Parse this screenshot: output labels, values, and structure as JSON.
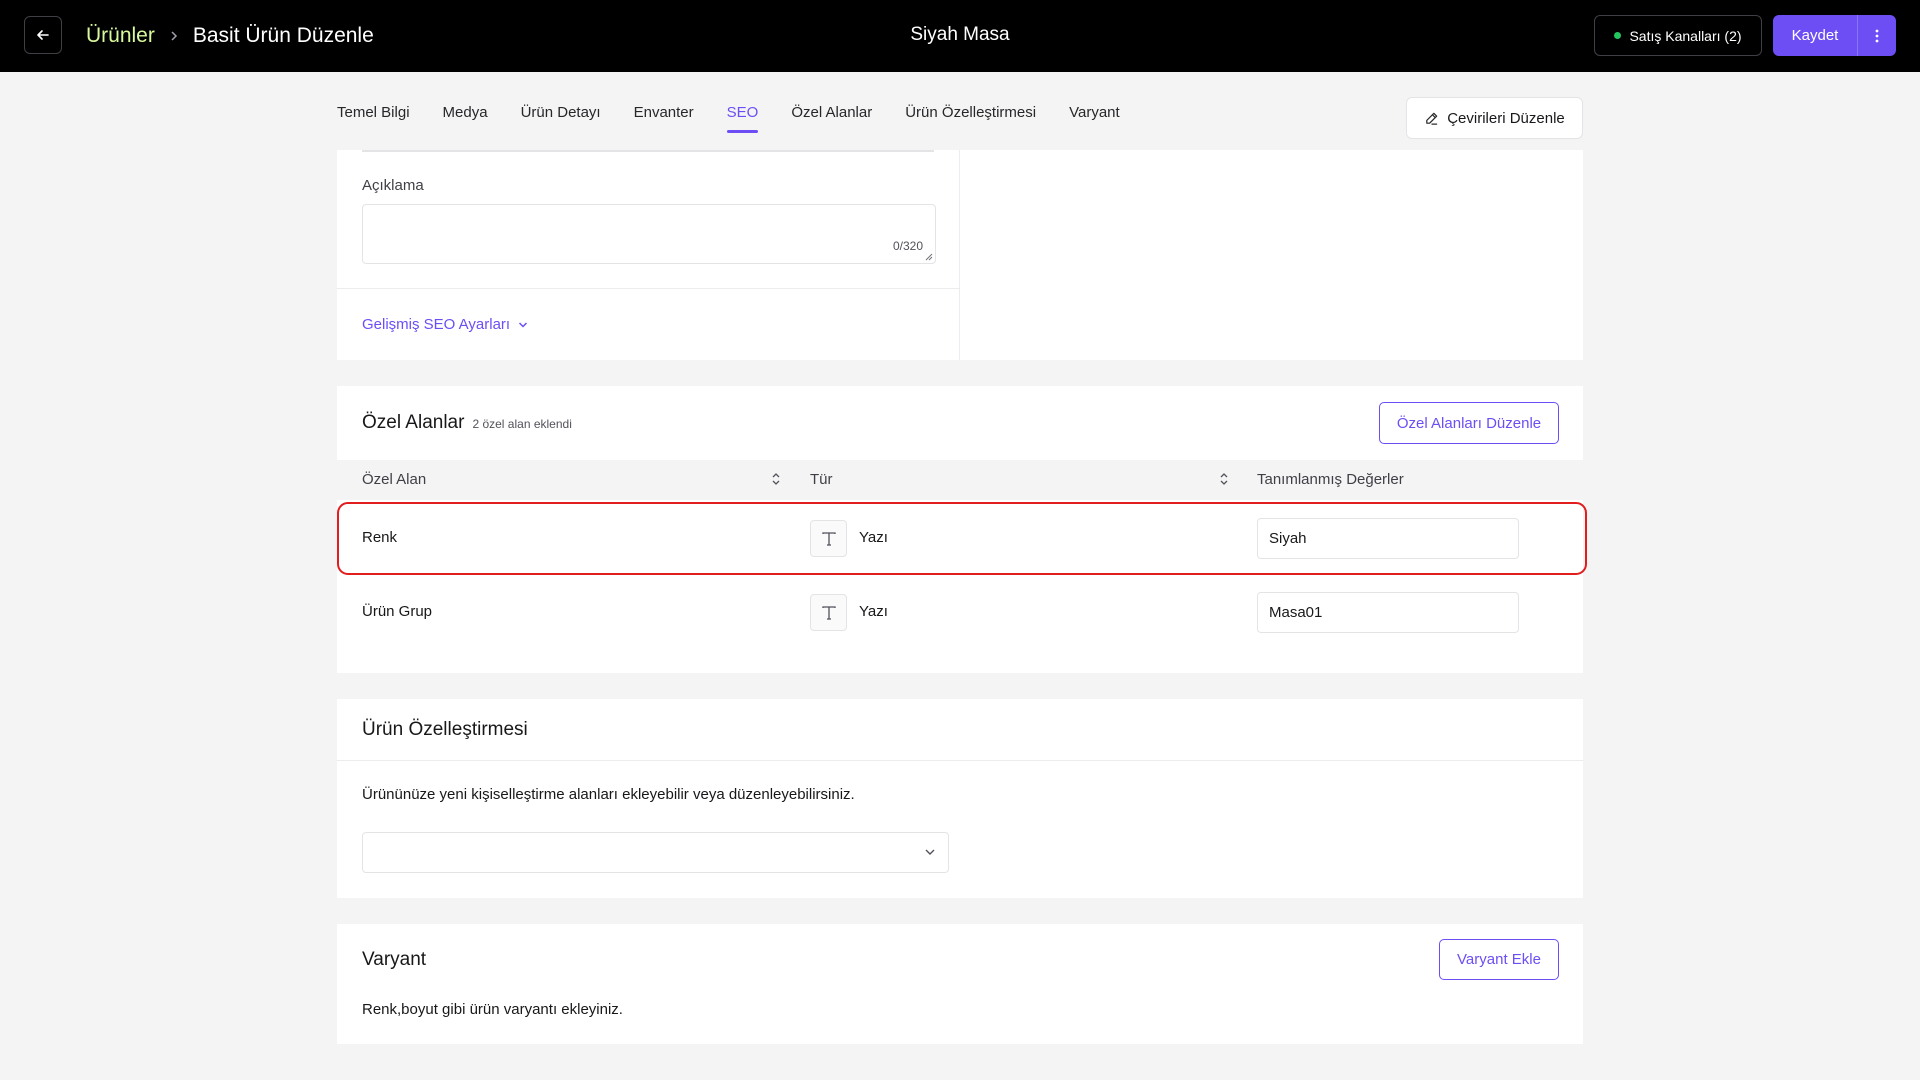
{
  "header": {
    "back_icon": "arrow-left-icon",
    "breadcrumb_parent": "Ürünler",
    "breadcrumb_current": "Basit Ürün Düzenle",
    "product_title": "Siyah Masa",
    "channels_label": "Satış Kanalları (2)",
    "channels_status_color": "#22c55e",
    "save_label": "Kaydet",
    "more_icon": "vertical-dots-icon",
    "accent_color": "#6d4ef5"
  },
  "tabs": [
    {
      "label": "Temel Bilgi",
      "active": false
    },
    {
      "label": "Medya",
      "active": false
    },
    {
      "label": "Ürün Detayı",
      "active": false
    },
    {
      "label": "Envanter",
      "active": false
    },
    {
      "label": "SEO",
      "active": true
    },
    {
      "label": "Özel Alanlar",
      "active": false
    },
    {
      "label": "Ürün Özelleştirmesi",
      "active": false
    },
    {
      "label": "Varyant",
      "active": false
    }
  ],
  "translations_button": "Çevirileri Düzenle",
  "seo": {
    "description_label": "Açıklama",
    "description_value": "",
    "description_counter": "0/320",
    "advanced_link": "Gelişmiş SEO Ayarları"
  },
  "custom_fields": {
    "title": "Özel Alanlar",
    "subtitle": "2 özel alan eklendi",
    "edit_button": "Özel Alanları Düzenle",
    "columns": [
      "Özel Alan",
      "Tür",
      "Tanımlanmış Değerler"
    ],
    "rows": [
      {
        "name": "Renk",
        "type_icon": "text-type-icon",
        "type": "Yazı",
        "value": "Siyah",
        "highlighted": true
      },
      {
        "name": "Ürün Grup",
        "type_icon": "text-type-icon",
        "type": "Yazı",
        "value": "Masa01",
        "highlighted": false
      }
    ],
    "highlight_color": "#e11d1d"
  },
  "customization": {
    "title": "Ürün Özelleştirmesi",
    "description": "Ürününüze yeni kişiselleştirme alanları ekleyebilir veya düzenleyebilirsiniz.",
    "select_value": ""
  },
  "variant": {
    "title": "Varyant",
    "add_button": "Varyant Ekle",
    "description": "Renk,boyut gibi ürün varyantı ekleyiniz."
  }
}
